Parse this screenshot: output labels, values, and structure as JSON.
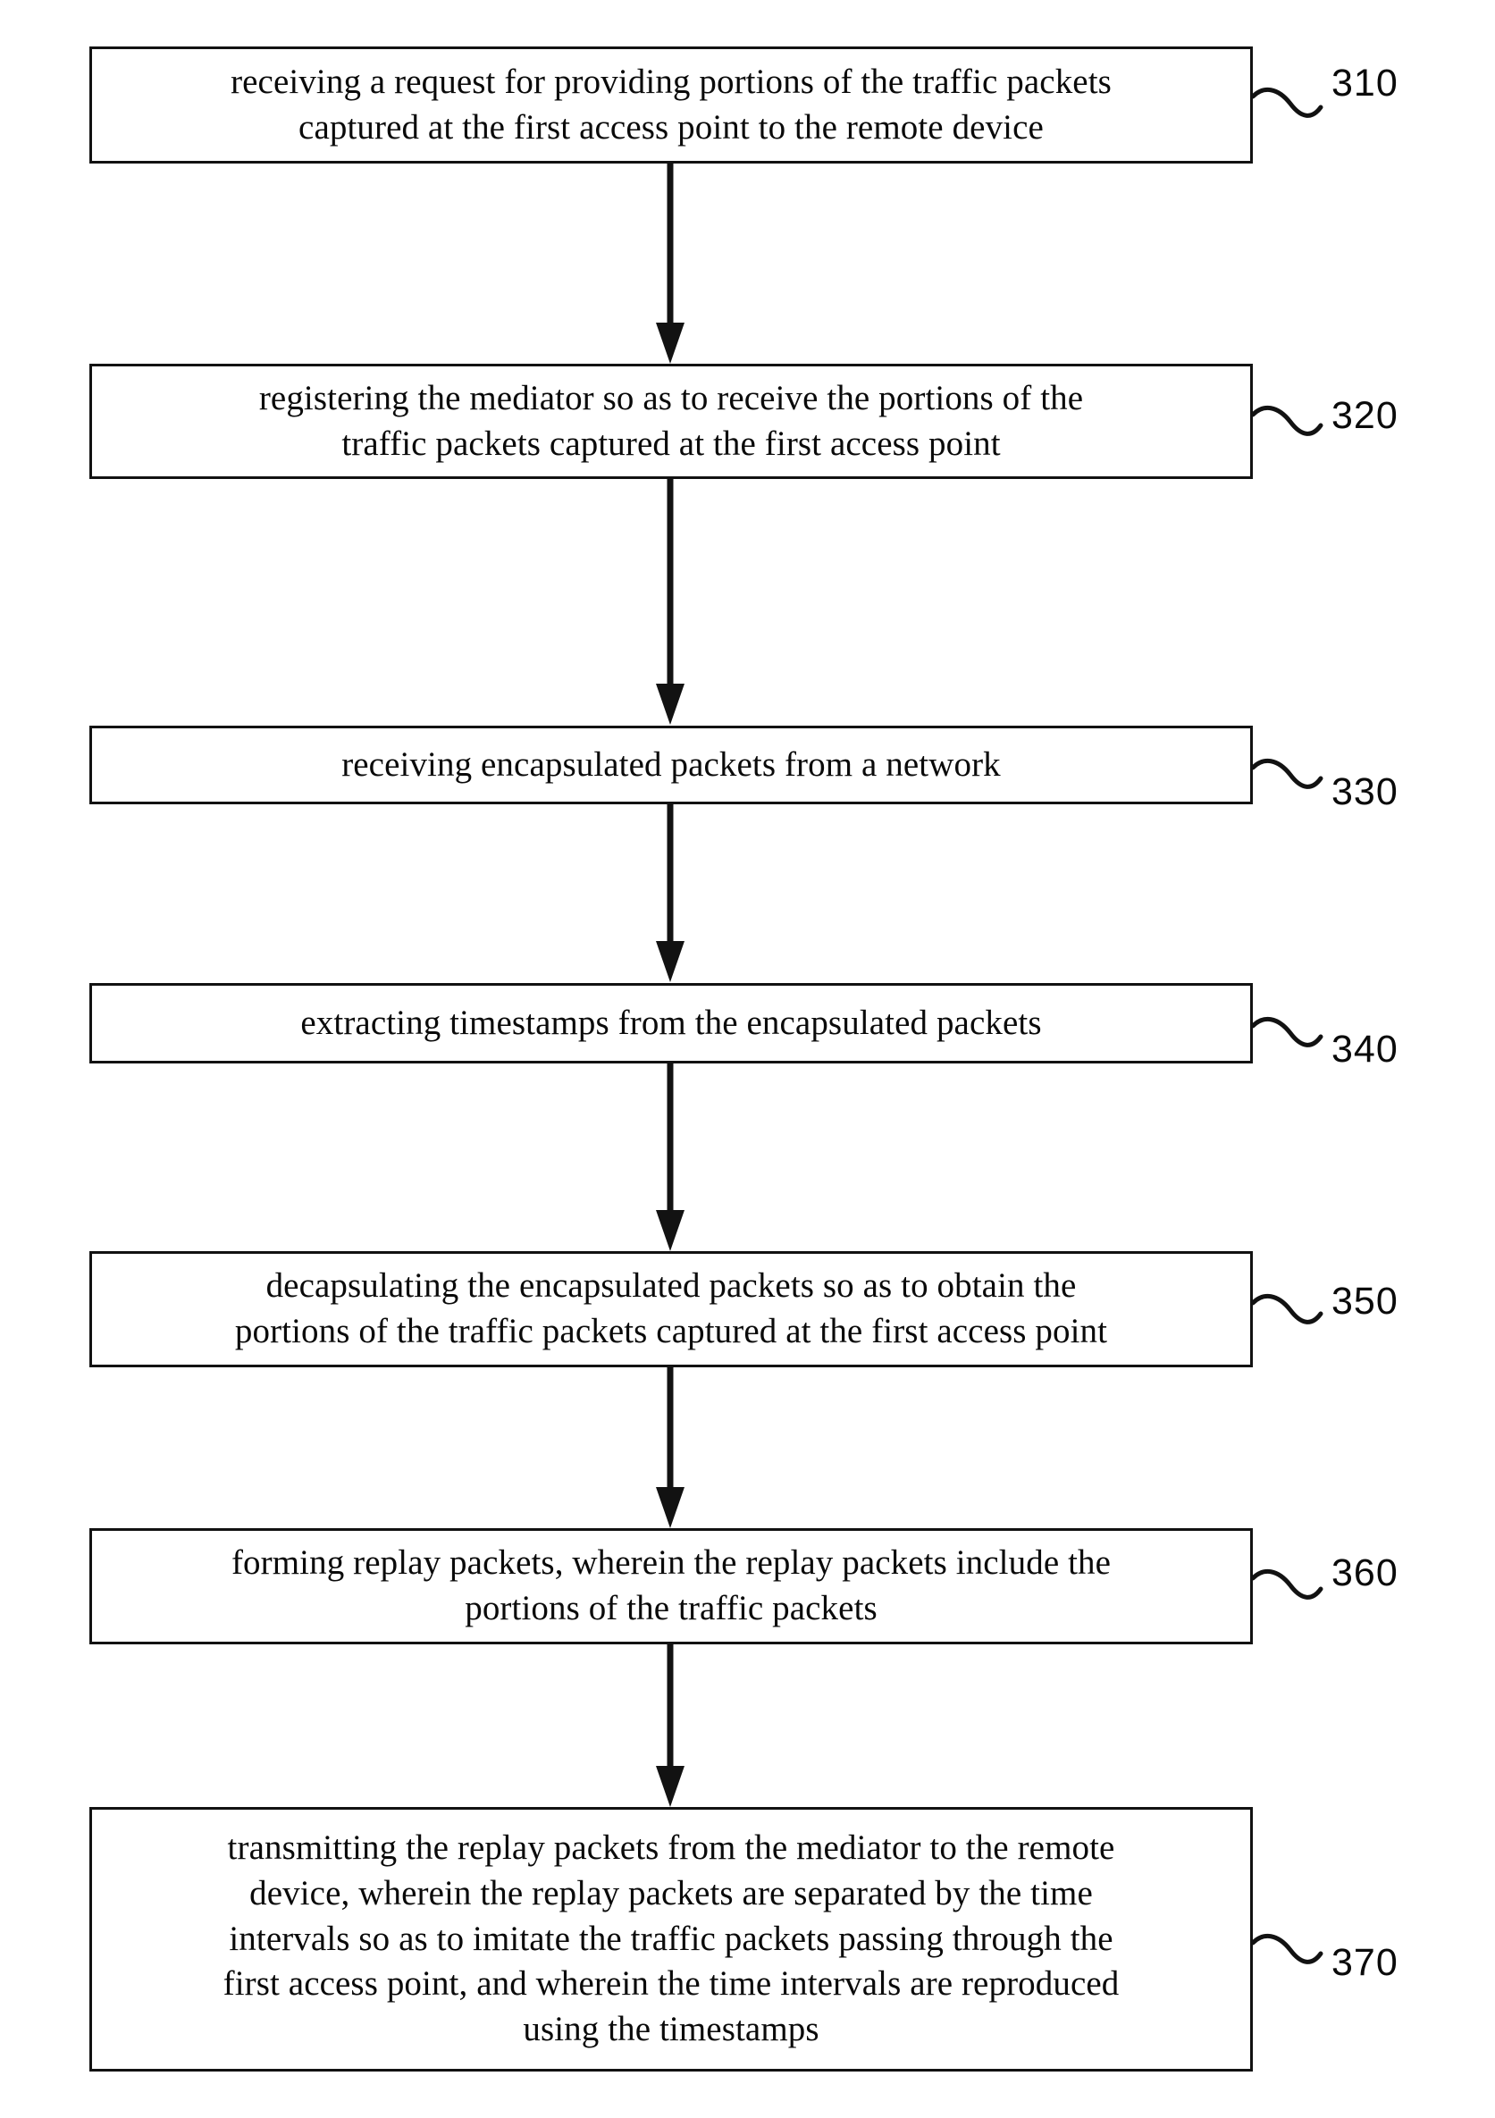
{
  "figure": {
    "type": "patent-flowchart",
    "orientation": "vertical-top-to-bottom",
    "step_count": 7
  },
  "steps": [
    {
      "ref": "310",
      "text": "receiving a request for providing portions of the traffic packets\ncaptured at the first access point to the remote device",
      "lines": 2
    },
    {
      "ref": "320",
      "text": "registering the mediator so as to receive the portions of the\ntraffic packets captured at the first access point",
      "lines": 2
    },
    {
      "ref": "330",
      "text": "receiving encapsulated packets from a network",
      "lines": 1
    },
    {
      "ref": "340",
      "text": "extracting timestamps from the encapsulated packets",
      "lines": 1
    },
    {
      "ref": "350",
      "text": "decapsulating the encapsulated packets so as to obtain the\nportions of the traffic packets captured at the first access point",
      "lines": 2
    },
    {
      "ref": "360",
      "text": "forming replay packets, wherein the replay packets include the\nportions of the traffic packets",
      "lines": 2
    },
    {
      "ref": "370",
      "text": "transmitting the replay packets from the mediator to the remote\ndevice, wherein the replay packets are separated by the time\nintervals so as to imitate the traffic packets passing through the\nfirst access point, and wherein the time intervals are reproduced\nusing the timestamps",
      "lines": 5
    }
  ],
  "connectors": [
    {
      "name": "arrow-310-to-320",
      "from": "310",
      "to": "320"
    },
    {
      "name": "arrow-320-to-330",
      "from": "320",
      "to": "330"
    },
    {
      "name": "arrow-330-to-340",
      "from": "330",
      "to": "340"
    },
    {
      "name": "arrow-340-to-350",
      "from": "340",
      "to": "350"
    },
    {
      "name": "arrow-350-to-360",
      "from": "350",
      "to": "360"
    },
    {
      "name": "arrow-360-to-370",
      "from": "360",
      "to": "370"
    }
  ],
  "colors": {
    "stroke": "#121212",
    "text": "#0a0a0a",
    "background": "#ffffff"
  }
}
